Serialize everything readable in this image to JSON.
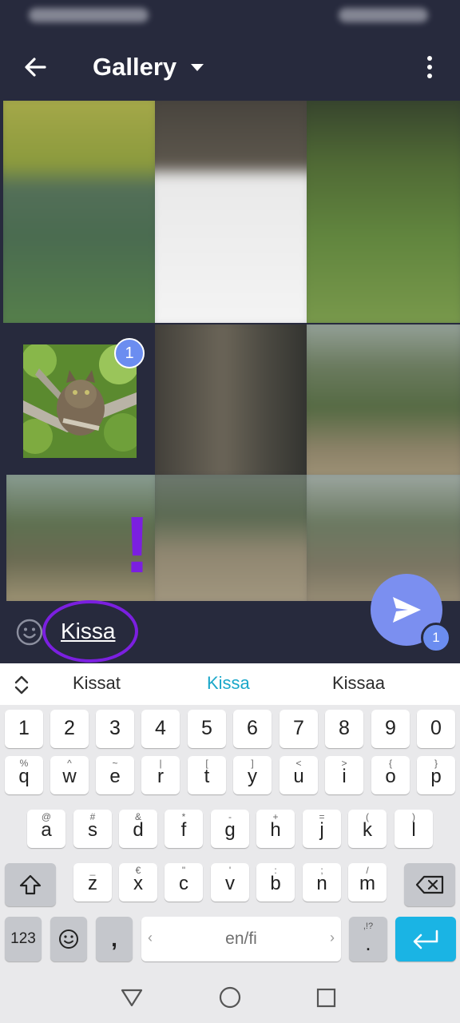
{
  "app": {
    "title": "Gallery",
    "caption_text": "Kissa",
    "photo_badge": "1",
    "send_badge": "1"
  },
  "suggestions": [
    "Kissat",
    "Kissa",
    "Kissaa"
  ],
  "annotation": {
    "mark": "!",
    "color": "#7b1fe0"
  },
  "colors": {
    "accent": "#6b8df0",
    "suggestion_active": "#1aa7c9",
    "enter_key": "#1ab4e4",
    "background": "#272a3d"
  },
  "keyboard": {
    "numbers": [
      "1",
      "2",
      "3",
      "4",
      "5",
      "6",
      "7",
      "8",
      "9",
      "0"
    ],
    "row1": [
      {
        "m": "q",
        "s": "%"
      },
      {
        "m": "w",
        "s": "^"
      },
      {
        "m": "e",
        "s": "~"
      },
      {
        "m": "r",
        "s": "|"
      },
      {
        "m": "t",
        "s": "["
      },
      {
        "m": "y",
        "s": "]"
      },
      {
        "m": "u",
        "s": "<"
      },
      {
        "m": "i",
        "s": ">"
      },
      {
        "m": "o",
        "s": "{"
      },
      {
        "m": "p",
        "s": "}"
      }
    ],
    "row2": [
      {
        "m": "a",
        "s": "@"
      },
      {
        "m": "s",
        "s": "#"
      },
      {
        "m": "d",
        "s": "&"
      },
      {
        "m": "f",
        "s": "*"
      },
      {
        "m": "g",
        "s": "-"
      },
      {
        "m": "h",
        "s": "+"
      },
      {
        "m": "j",
        "s": "="
      },
      {
        "m": "k",
        "s": "("
      },
      {
        "m": "l",
        "s": ")"
      }
    ],
    "row3": [
      {
        "m": "z",
        "s": "_"
      },
      {
        "m": "x",
        "s": "€"
      },
      {
        "m": "c",
        "s": "\""
      },
      {
        "m": "v",
        "s": "'"
      },
      {
        "m": "b",
        "s": ":"
      },
      {
        "m": "n",
        "s": ";"
      },
      {
        "m": "m",
        "s": "/"
      }
    ],
    "sym_label": "123",
    "comma": ",",
    "space_label": "en/fi",
    "period": ".",
    "period_alt": ",!?"
  }
}
